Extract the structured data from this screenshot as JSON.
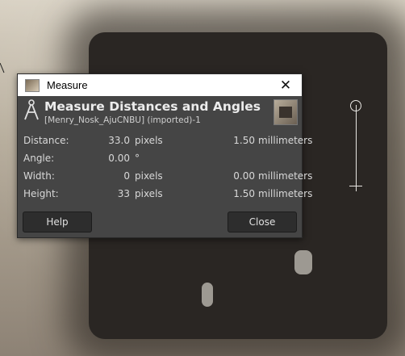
{
  "titlebar": {
    "title": "Measure",
    "close_glyph": "✕"
  },
  "header": {
    "title": "Measure Distances and Angles",
    "subtitle": "[Menry_Nosk_AjuCNBU] (imported)-1"
  },
  "rows": [
    {
      "label": "Distance:",
      "value": "33.0",
      "unit": "pixels",
      "value2": "1.50",
      "unit2": "millimeters"
    },
    {
      "label": "Angle:",
      "value": "0.00",
      "unit": "°",
      "value2": "",
      "unit2": ""
    },
    {
      "label": "Width:",
      "value": "0",
      "unit": "pixels",
      "value2": "0.00",
      "unit2": "millimeters"
    },
    {
      "label": "Height:",
      "value": "33",
      "unit": "pixels",
      "value2": "1.50",
      "unit2": "millimeters"
    }
  ],
  "buttons": {
    "help": "Help",
    "close": "Close"
  },
  "icons": {
    "tool": "compass-icon",
    "close": "close-icon",
    "app": "gimp-image-icon",
    "thumbnail": "image-thumbnail"
  },
  "colors": {
    "dialog_bg": "#454545",
    "button_bg": "#2d2d2d",
    "text": "#d8d8d8"
  }
}
